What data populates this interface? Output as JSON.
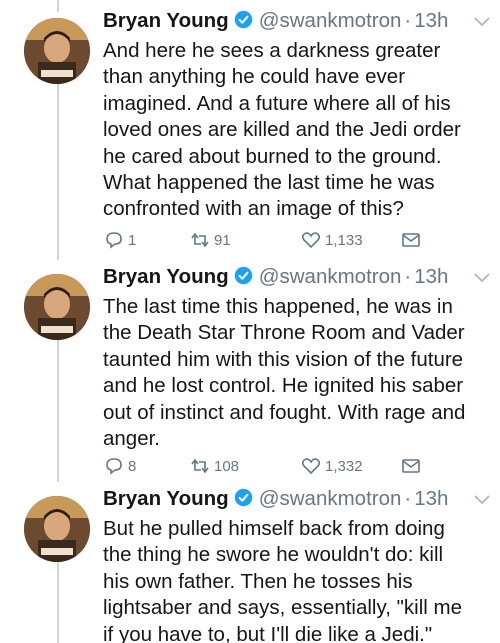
{
  "colors": {
    "text": "#14171a",
    "muted": "#657786",
    "verified": "#1da1f2",
    "thread": "#ccd6dd"
  },
  "icons": [
    "verified-badge-icon",
    "chevron-down-icon",
    "reply-icon",
    "retweet-icon",
    "like-icon",
    "message-icon"
  ],
  "tweets": [
    {
      "name": "Bryan Young",
      "handle": "@swankmotron",
      "separator": "·",
      "time": "13h",
      "text": "And here he sees a darkness greater\nthan anything he could have ever\nimagined. And a future where all of his\nloved ones are killed and the Jedi order\nhe cared about burned to the ground.\nWhat happened the last time he was\nconfronted with an image of this?",
      "replies": "1",
      "retweets": "91",
      "likes": "1,133"
    },
    {
      "name": "Bryan Young",
      "handle": "@swankmotron",
      "separator": "·",
      "time": "13h",
      "text": "The last time this happened, he was in\nthe Death Star Throne Room and Vader\ntaunted him with this vision of the future\nand he lost control. He ignited his saber\nout of instinct and fought. With rage and\nanger.",
      "replies": "8",
      "retweets": "108",
      "likes": "1,332"
    },
    {
      "name": "Bryan Young",
      "handle": "@swankmotron",
      "separator": "·",
      "time": "13h",
      "text": "But he pulled himself back from doing\nthe thing he swore he wouldn't do: kill\nhis own father. Then he tosses his\nlightsaber and says, essentially, \"kill me\nif you have to, but I'll die like a Jedi.\""
    }
  ]
}
